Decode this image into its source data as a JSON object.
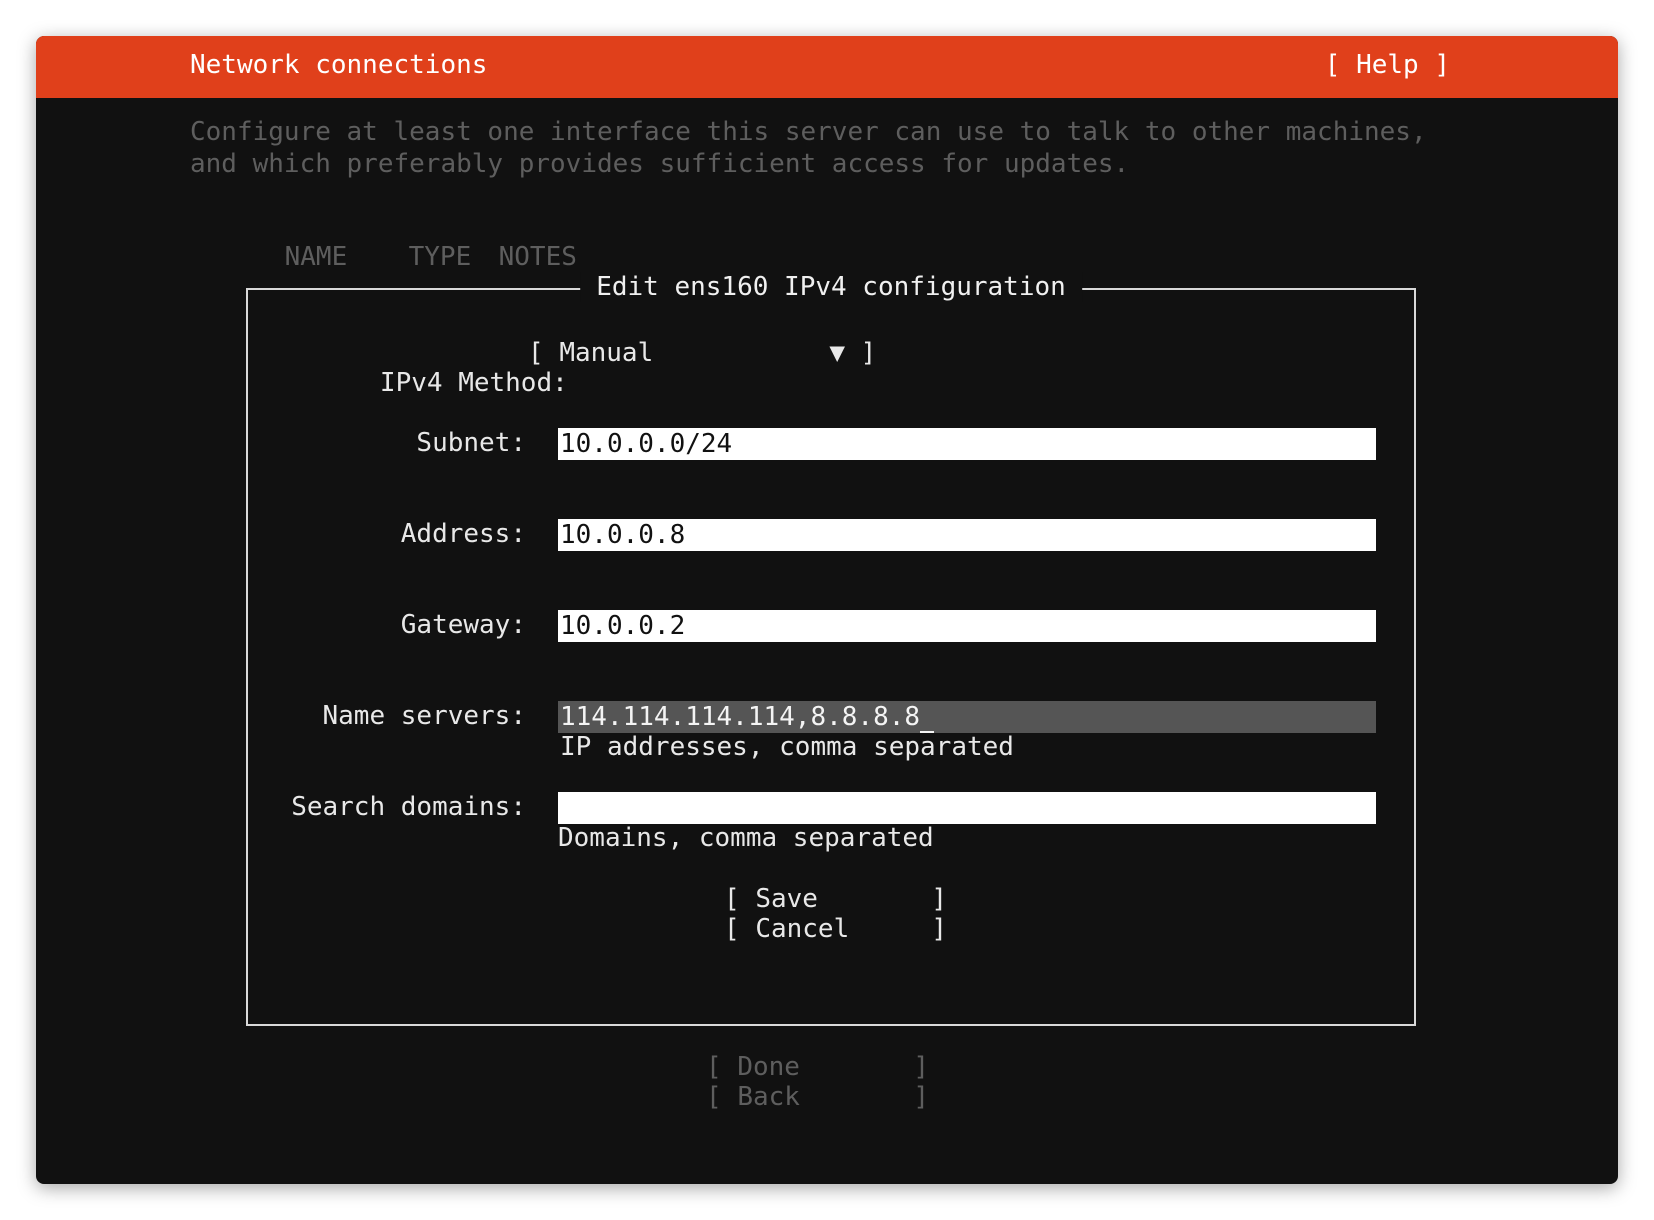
{
  "header": {
    "title": "Network connections",
    "help_label": "[ Help ]"
  },
  "description": {
    "line1": "Configure at least one interface this server can use to talk to other machines,",
    "line2": "and which preferably provides sufficient access for updates."
  },
  "table": {
    "columns": [
      "NAME",
      "TYPE",
      "NOTES"
    ]
  },
  "dialog": {
    "title": "Edit ens160 IPv4 configuration",
    "method_label": "IPv4 Method:",
    "method_open_bracket": "[",
    "method_value": "Manual",
    "method_arrow": "▼",
    "method_close_bracket": "]",
    "fields": {
      "subnet": {
        "label": "Subnet:",
        "value": "10.0.0.0/24"
      },
      "address": {
        "label": "Address:",
        "value": "10.0.0.8"
      },
      "gateway": {
        "label": "Gateway:",
        "value": "10.0.0.2"
      },
      "name_servers": {
        "label": "Name servers:",
        "value": "114.114.114.114,8.8.8.8",
        "hint": "IP addresses, comma separated"
      },
      "search_domains": {
        "label": "Search domains:",
        "value": "",
        "hint": "Domains, comma separated"
      }
    },
    "buttons": {
      "save": "Save",
      "cancel": "Cancel"
    }
  },
  "footer": {
    "done": "Done",
    "back": "Back"
  },
  "bracket_open": "[",
  "bracket_close": "]",
  "colors": {
    "accent": "#e0401b",
    "background": "#111111",
    "dim_text": "#5e5e5e",
    "active_field": "#555555"
  }
}
